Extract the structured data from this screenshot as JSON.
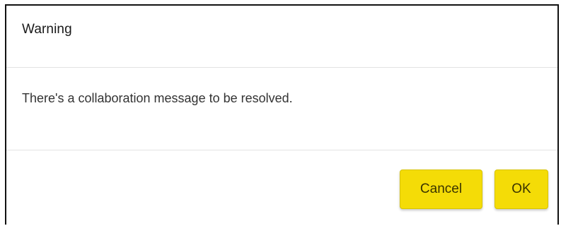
{
  "dialog": {
    "title": "Warning",
    "message": "There's a collaboration message to be resolved.",
    "buttons": {
      "cancel_label": "Cancel",
      "ok_label": "OK"
    },
    "colors": {
      "button_background": "#f4dc07",
      "button_text": "#3a3400",
      "divider": "#e3e3e3"
    }
  }
}
